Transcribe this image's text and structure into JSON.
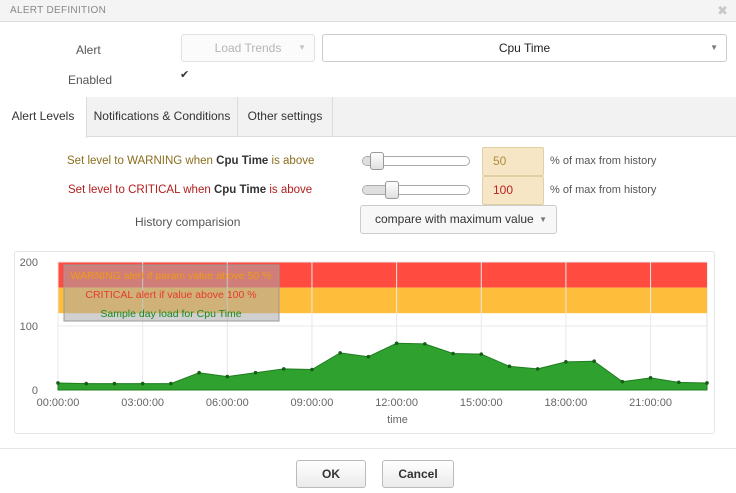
{
  "dialog": {
    "title": "ALERT DEFINITION",
    "close_glyph": "✖"
  },
  "form": {
    "alert_label": "Alert",
    "enabled_label": "Enabled",
    "alert_type_value": "Load Trends",
    "alert_param_value": "Cpu Time",
    "enabled_checked": true
  },
  "tabs": [
    "Alert Levels",
    "Notifications & Conditions",
    "Other settings"
  ],
  "levels": {
    "warning_prefix": "Set level to WARNING when",
    "critical_prefix": "Set level to CRITICAL when",
    "param": "Cpu Time",
    "suffix_word": "is above",
    "warning_value": "50",
    "critical_value": "100",
    "unit_text": "% of max from history",
    "history_label": "History comparision",
    "history_value": "compare with maximum value"
  },
  "colors": {
    "critical_band": "#ff4b40",
    "warning_band": "#ffbd3c",
    "area": "#2ea12e",
    "warning_text": "#f09a14",
    "critical_text": "#e53b2a",
    "sample_text": "#1a8a1a"
  },
  "chart_data": {
    "type": "area",
    "y_ticks": [
      "200",
      "100",
      "0"
    ],
    "ylim": [
      0,
      200
    ],
    "x_tick_labels": [
      "00:00:00",
      "03:00:00",
      "06:00:00",
      "09:00:00",
      "12:00:00",
      "15:00:00",
      "18:00:00",
      "21:00:00"
    ],
    "xlabel": "time",
    "grid": true,
    "legend_position": "top-left",
    "legend": [
      "WARNING alert if param value above 50 %",
      "CRITICAL alert if value above 100 %",
      "Sample day load for Cpu Time"
    ],
    "thresholds": {
      "warning_from": 120,
      "critical_from": 160,
      "max": 200
    },
    "hours": [
      0,
      1,
      2,
      3,
      4,
      5,
      6,
      7,
      8,
      9,
      10,
      11,
      12,
      13,
      14,
      15,
      16,
      17,
      18,
      19,
      20,
      21,
      22,
      23
    ],
    "values": [
      11,
      10,
      10,
      10,
      10,
      27,
      21,
      27,
      33,
      32,
      58,
      52,
      73,
      72,
      57,
      56,
      37,
      33,
      44,
      45,
      13,
      19,
      12,
      11
    ]
  },
  "buttons": {
    "ok": "OK",
    "cancel": "Cancel"
  }
}
